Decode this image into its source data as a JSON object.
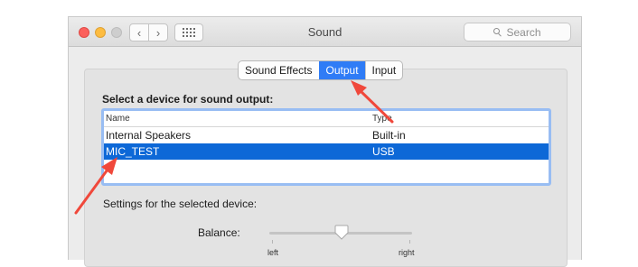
{
  "window": {
    "title": "Sound",
    "search_placeholder": "Search",
    "nav": {
      "back_glyph": "‹",
      "forward_glyph": "›"
    }
  },
  "tabs": [
    {
      "label": "Sound Effects",
      "active": false
    },
    {
      "label": "Output",
      "active": true
    },
    {
      "label": "Input",
      "active": false
    }
  ],
  "output": {
    "section_label": "Select a device for sound output:",
    "columns": {
      "name": "Name",
      "type": "Type"
    },
    "devices": [
      {
        "name": "Internal Speakers",
        "type": "Built-in",
        "selected": false
      },
      {
        "name": "MIC_TEST",
        "type": "USB",
        "selected": true
      }
    ]
  },
  "settings": {
    "label": "Settings for the selected device:",
    "balance_label": "Balance:",
    "balance_left": "left",
    "balance_right": "right",
    "balance_value": 0.5
  },
  "colors": {
    "accent": "#2f7cf6",
    "selection": "#0d68d7",
    "annotation_arrow": "#f0483b"
  },
  "icons": [
    "back-chevron-icon",
    "forward-chevron-icon",
    "app-grid-icon",
    "search-icon",
    "slider-knob-icon",
    "annotation-arrow"
  ]
}
